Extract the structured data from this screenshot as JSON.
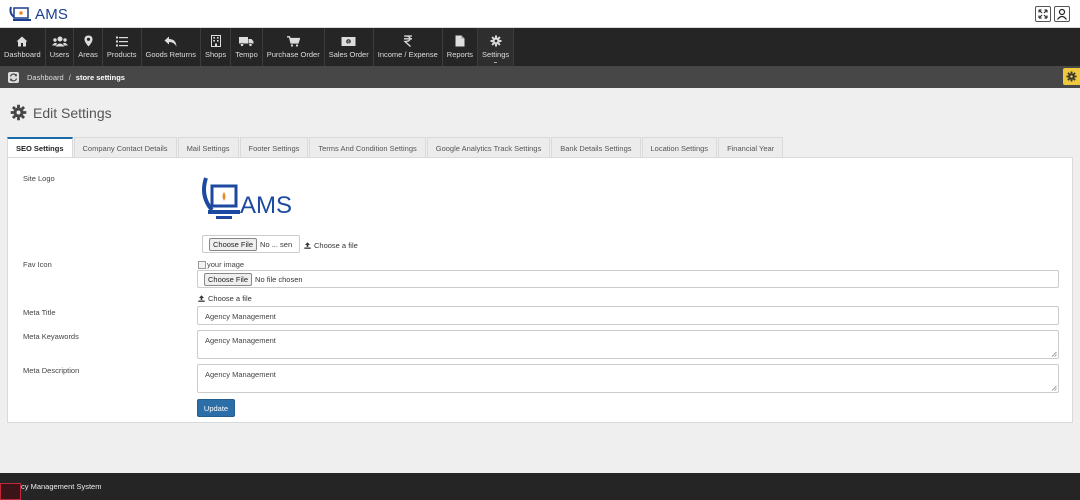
{
  "brand": {
    "name": "AMS"
  },
  "nav": {
    "items": [
      {
        "label": "Dashboard",
        "icon": "home-icon"
      },
      {
        "label": "Users",
        "icon": "users-icon"
      },
      {
        "label": "Areas",
        "icon": "map-marker-icon"
      },
      {
        "label": "Products",
        "icon": "list-icon"
      },
      {
        "label": "Goods Returns",
        "icon": "reply-icon"
      },
      {
        "label": "Shops",
        "icon": "building-icon"
      },
      {
        "label": "Tempo",
        "icon": "truck-icon"
      },
      {
        "label": "Purchase Order",
        "icon": "cart-icon"
      },
      {
        "label": "Sales Order",
        "icon": "money-icon"
      },
      {
        "label": "Income / Expense",
        "icon": "rupee-icon"
      },
      {
        "label": "Reports",
        "icon": "file-icon"
      },
      {
        "label": "Settings",
        "icon": "gear-icon"
      }
    ],
    "active": "Settings"
  },
  "breadcrumb": {
    "home": "Dashboard",
    "separator": "/",
    "current": "store settings"
  },
  "page": {
    "title": "Edit Settings"
  },
  "tabs": [
    "SEO Settings",
    "Company Contact Details",
    "Mail Settings",
    "Footer Settings",
    "Terms And Condition Settings",
    "Google Analytics Track Settings",
    "Bank Details Settings",
    "Location Settings",
    "Financial Year"
  ],
  "form": {
    "site_logo_label": "Site Logo",
    "logo_text": "AMS",
    "logo_file_button": "Choose File",
    "logo_file_status": "No ... sen",
    "logo_choose_link": "Choose a file",
    "fav_icon_label": "Fav Icon",
    "fav_image_alt": "your image",
    "fav_file_button": "Choose File",
    "fav_file_status": "No file chosen",
    "fav_choose_link": "Choose a file",
    "meta_title_label": "Meta Title",
    "meta_title_value": "Agency Management",
    "meta_keywords_label": "Meta Keyawords",
    "meta_keywords_value": "Agency Management",
    "meta_description_label": "Meta Description",
    "meta_description_value": "Agency Management",
    "update_button": "Update"
  },
  "footer": {
    "text": "cy Management System"
  },
  "colors": {
    "nav_bg": "#252525",
    "breadcrumb_bg": "#474747",
    "accent": "#2b6ea8",
    "brand": "#1d3f8f",
    "gear_badge": "#f0c83c"
  }
}
